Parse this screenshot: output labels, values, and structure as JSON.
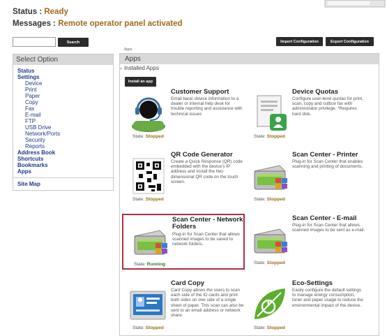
{
  "status": {
    "label": "Status :",
    "value": "Ready"
  },
  "messages": {
    "label": "Messages :",
    "value": "Remote operator panel activated"
  },
  "search": {
    "placeholder": "",
    "button": "Search"
  },
  "toolbar": {
    "import_label": "Import Configuration",
    "export_label": "Export Configuration"
  },
  "sidebar": {
    "heading": "Select Option",
    "items": [
      {
        "label": "Status",
        "level": "top"
      },
      {
        "label": "Settings",
        "level": "top"
      },
      {
        "label": "Device",
        "level": "sub"
      },
      {
        "label": "Print",
        "level": "sub"
      },
      {
        "label": "Paper",
        "level": "sub"
      },
      {
        "label": "Copy",
        "level": "sub"
      },
      {
        "label": "Fax",
        "level": "sub"
      },
      {
        "label": "E-mail",
        "level": "sub"
      },
      {
        "label": "FTP",
        "level": "sub"
      },
      {
        "label": "USB Drive",
        "level": "sub"
      },
      {
        "label": "Network/Ports",
        "level": "sub"
      },
      {
        "label": "Security",
        "level": "sub"
      },
      {
        "label": "Reports",
        "level": "sub"
      },
      {
        "label": "Address Book",
        "level": "top"
      },
      {
        "label": "Shortcuts",
        "level": "top"
      },
      {
        "label": "Bookmarks",
        "level": "top"
      },
      {
        "label": "Apps",
        "level": "top"
      }
    ],
    "site_map": "Site Map"
  },
  "breadcrumb": "Apps",
  "main": {
    "heading": "Apps",
    "installed_label": "Installed Apps",
    "install_button": "Install an app"
  },
  "apps": [
    {
      "title": "Customer Support",
      "description": "Email basic device information to a dealer or internal help desk for trouble reporting and assistance with technical issues",
      "state_label": "State:",
      "state": "Stopped",
      "icon": "headset-icon"
    },
    {
      "title": "Device Quotas",
      "description": "Configure user-level quotas for print, scan, copy and outbox fax with administrator privilege. *Requires hard disk.",
      "state_label": "State:",
      "state": "Stopped",
      "icon": "quota-icon"
    },
    {
      "title": "QR Code Generator",
      "description": "Create a Quick Response (QR) code embedded with the device's IP address and install the two-dimensional QR code on the touch screen.",
      "state_label": "State:",
      "state": "Stopped",
      "icon": "qr-code-icon"
    },
    {
      "title": "Scan Center - Printer",
      "description": "Plug-in for Scan Center that enables scanning and printing of documents.",
      "state_label": "State:",
      "state": "Stopped",
      "icon": "scanner-icon"
    },
    {
      "title": "Scan Center - Network Folders",
      "description": "Plug-in for Scan Center that allows scanned images to be saved to network folders.",
      "state_label": "State:",
      "state": "Running",
      "icon": "scanner-icon"
    },
    {
      "title": "Scan Center - E-mail",
      "description": "Plug-in for Scan Center that allows scanned images to be sent as e-mail.",
      "state_label": "State:",
      "state": "Stopped",
      "icon": "scanner-icon"
    },
    {
      "title": "Card Copy",
      "description": "Card Copy allows the users to scan each side of the ID cards and print both sides on one side of a single sheet of paper. This scan can also be sent to an email address or network share.",
      "state_label": "State:",
      "state": "Stopped",
      "icon": "id-card-icon"
    },
    {
      "title": "Eco-Settings",
      "description": "Easily configure the default settings to manage energy consumption, toner and paper usage to reduce the environmental impact of the device.",
      "state_label": "State:",
      "state": "Stopped",
      "icon": "leaf-icon"
    }
  ],
  "colors": {
    "status_value": "#a06a1a",
    "nav_link": "#1f3a8a",
    "selected_border": "#b0303a",
    "running": "#2a7a3b"
  }
}
